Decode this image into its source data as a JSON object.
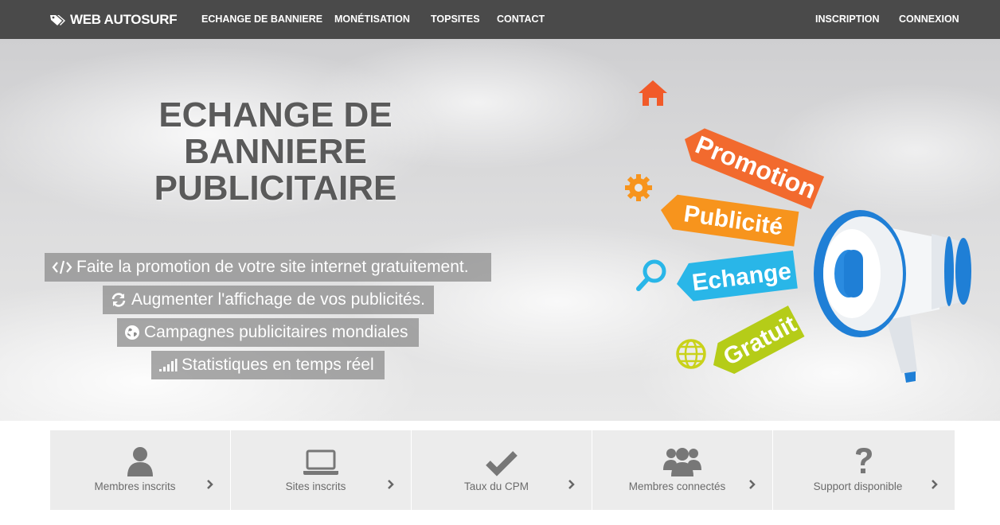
{
  "nav": {
    "brand": "WEB AUTOSURF",
    "links": [
      "ECHANGE DE BANNIERE",
      "MONÉTISATION",
      "TOPSITES",
      "CONTACT"
    ],
    "right_links": [
      "INSCRIPTION",
      "CONNEXION"
    ]
  },
  "hero": {
    "title_lines": [
      "ECHANGE DE",
      "BANNIERE",
      "PUBLICITAIRE"
    ],
    "features": [
      {
        "icon": "code-icon",
        "text": "Faite la promotion de votre site internet gratuitement."
      },
      {
        "icon": "refresh-icon",
        "text": "Augmenter l'affichage de vos publicités."
      },
      {
        "icon": "globe-icon",
        "text": "Campagnes publicitaires mondiales"
      },
      {
        "icon": "signal-icon",
        "text": "Statistiques en temps réel"
      }
    ],
    "illustration_tags": [
      "Promotion",
      "Publicité",
      "Echange",
      "Gratuit"
    ]
  },
  "stats": [
    {
      "icon": "user-icon",
      "label": "Membres inscrits"
    },
    {
      "icon": "laptop-icon",
      "label": "Sites inscrits"
    },
    {
      "icon": "check-icon",
      "label": "Taux du CPM"
    },
    {
      "icon": "users-icon",
      "label": "Membres connectés"
    },
    {
      "icon": "question-icon",
      "label": "Support disponible"
    }
  ],
  "colors": {
    "navbar": "#4a4a4a",
    "promotion_tag": "#f26a2e",
    "publicite_tag": "#f7941d",
    "echange_tag": "#29b6e8",
    "gratuit_tag": "#b5cc18",
    "stat_box": "#ececec"
  }
}
